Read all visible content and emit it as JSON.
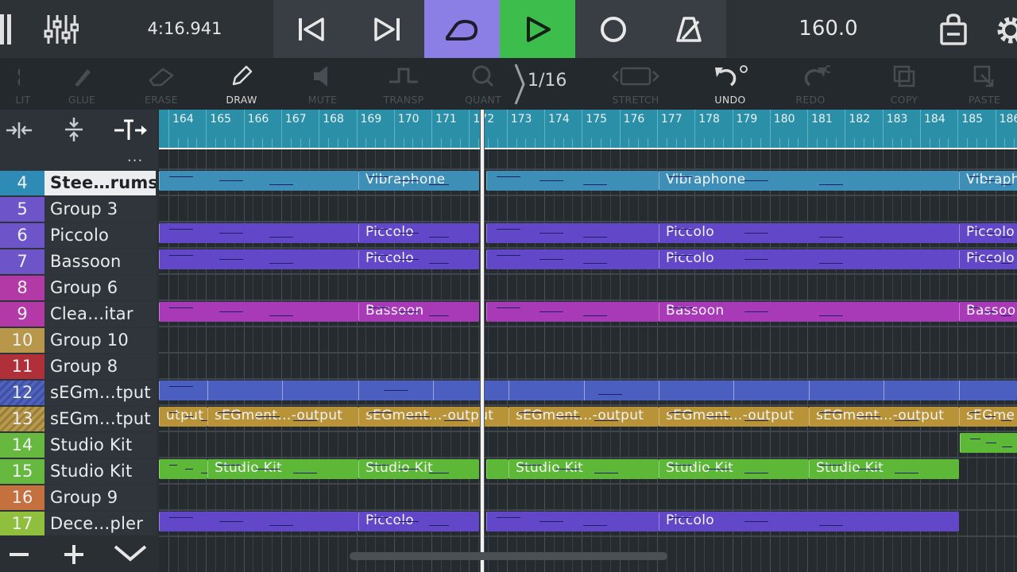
{
  "transport": {
    "time": "4:16.941",
    "tempo": "160.0",
    "accent_loop": "#8b7fe6",
    "accent_play": "#3dbd4b"
  },
  "toolbar": {
    "tools": [
      {
        "label": "LIT",
        "icon": "split-icon",
        "active": false
      },
      {
        "label": "GLUE",
        "icon": "glue-icon",
        "active": false
      },
      {
        "label": "ERASE",
        "icon": "eraser-icon",
        "active": false
      },
      {
        "label": "DRAW",
        "icon": "pencil-icon",
        "active": true
      },
      {
        "label": "MUTE",
        "icon": "speaker-icon",
        "active": false
      },
      {
        "label": "TRANSP",
        "icon": "transpose-icon",
        "active": false
      },
      {
        "label": "QUANT",
        "icon": "quantize-icon",
        "active": false
      },
      {
        "label": "STRETCH",
        "icon": "stretch-icon",
        "active": false
      },
      {
        "label": "UNDO",
        "icon": "undo-icon",
        "active": true
      },
      {
        "label": "REDO",
        "icon": "redo-icon",
        "active": false
      },
      {
        "label": "COPY",
        "icon": "copy-icon",
        "active": false
      },
      {
        "label": "PASTE",
        "icon": "paste-icon",
        "active": false
      }
    ],
    "quantize": "1/16"
  },
  "panel": {
    "more": "..."
  },
  "ruler": {
    "bars": [
      "164",
      "165",
      "166",
      "167",
      "168",
      "169",
      "170",
      "171",
      "172",
      "173",
      "174",
      "175",
      "176",
      "177",
      "178",
      "179",
      "180",
      "181",
      "182",
      "183",
      "184",
      "185",
      "186"
    ]
  },
  "tracks": [
    {
      "num": "4",
      "name": "Stee…rums",
      "color": "#2e8bb5",
      "selected": true
    },
    {
      "num": "5",
      "name": "Group 3",
      "color": "#6d55c9"
    },
    {
      "num": "6",
      "name": "Piccolo",
      "color": "#6d55c9"
    },
    {
      "num": "7",
      "name": "Bassoon",
      "color": "#6d55c9"
    },
    {
      "num": "8",
      "name": "Group 6",
      "color": "#b33aa6"
    },
    {
      "num": "9",
      "name": "Clea…itar",
      "color": "#b33aa6"
    },
    {
      "num": "10",
      "name": "Group 10",
      "color": "#b8964a"
    },
    {
      "num": "11",
      "name": "Group 8",
      "color": "#b0303a"
    },
    {
      "num": "12",
      "name": "sEGm…tput",
      "color": "#4e62c0",
      "hatched": true
    },
    {
      "num": "13",
      "name": "sEGm…tput",
      "color": "#b89a4a",
      "hatched": true
    },
    {
      "num": "14",
      "name": "Studio Kit",
      "color": "#67b83e"
    },
    {
      "num": "15",
      "name": "Studio Kit",
      "color": "#67b83e"
    },
    {
      "num": "16",
      "name": "Group 9",
      "color": "#c4703f"
    },
    {
      "num": "17",
      "name": "Dece…pler",
      "color": "#8fbf3c"
    }
  ],
  "clips": [
    {
      "lane": 0,
      "label": "",
      "color": "#3e8fb8"
    },
    {
      "lane": 0,
      "label": "Vibraphone",
      "color": "#3e8fb8"
    },
    {
      "lane": 0,
      "label": "",
      "color": "#3e8fb8"
    },
    {
      "lane": 0,
      "label": "Vibraphone",
      "color": "#3e8fb8"
    },
    {
      "lane": 0,
      "label": "Vibraph",
      "color": "#3e8fb8"
    },
    {
      "lane": 2,
      "label": "",
      "color": "#6248c8"
    },
    {
      "lane": 2,
      "label": "Piccolo",
      "color": "#6248c8"
    },
    {
      "lane": 2,
      "label": "",
      "color": "#6248c8"
    },
    {
      "lane": 2,
      "label": "Piccolo",
      "color": "#6248c8"
    },
    {
      "lane": 2,
      "label": "Piccolo",
      "color": "#6248c8"
    },
    {
      "lane": 3,
      "label": "",
      "color": "#6248c8"
    },
    {
      "lane": 3,
      "label": "Piccolo",
      "color": "#6248c8"
    },
    {
      "lane": 3,
      "label": "",
      "color": "#6248c8"
    },
    {
      "lane": 3,
      "label": "Piccolo",
      "color": "#6248c8"
    },
    {
      "lane": 3,
      "label": "Piccolo",
      "color": "#6248c8"
    },
    {
      "lane": 5,
      "label": "",
      "color": "#a83ab8"
    },
    {
      "lane": 5,
      "label": "Bassoon",
      "color": "#a83ab8"
    },
    {
      "lane": 5,
      "label": "",
      "color": "#a83ab8"
    },
    {
      "lane": 5,
      "label": "Bassoon",
      "color": "#a83ab8"
    },
    {
      "lane": 5,
      "label": "Bassoo",
      "color": "#a83ab8"
    },
    {
      "lane": 8,
      "label": "",
      "color": "#4a5fc0"
    },
    {
      "lane": 9,
      "label": "utput",
      "color": "#b89338"
    },
    {
      "lane": 9,
      "label": "sEGment…-output",
      "color": "#b89338"
    },
    {
      "lane": 9,
      "label": "sEGment…-output",
      "color": "#b89338"
    },
    {
      "lane": 9,
      "label": "sEGment…-output",
      "color": "#b89338"
    },
    {
      "lane": 9,
      "label": "sEGment…-output",
      "color": "#b89338"
    },
    {
      "lane": 9,
      "label": "sEGment…-output",
      "color": "#b89338"
    },
    {
      "lane": 9,
      "label": "sEGme",
      "color": "#b89338"
    },
    {
      "lane": 10,
      "label": "",
      "color": "#5db838"
    },
    {
      "lane": 11,
      "label": "",
      "color": "#5db838"
    },
    {
      "lane": 11,
      "label": "Studio Kit",
      "color": "#5db838"
    },
    {
      "lane": 11,
      "label": "Studio Kit",
      "color": "#5db838"
    },
    {
      "lane": 11,
      "label": "",
      "color": "#5db838"
    },
    {
      "lane": 11,
      "label": "Studio Kit",
      "color": "#5db838"
    },
    {
      "lane": 11,
      "label": "Studio Kit",
      "color": "#5db838"
    },
    {
      "lane": 11,
      "label": "Studio Kit",
      "color": "#5db838"
    },
    {
      "lane": 13,
      "label": "",
      "color": "#6248c8"
    },
    {
      "lane": 13,
      "label": "Piccolo",
      "color": "#6248c8"
    },
    {
      "lane": 13,
      "label": "",
      "color": "#6248c8"
    },
    {
      "lane": 13,
      "label": "Piccolo",
      "color": "#6248c8"
    }
  ]
}
